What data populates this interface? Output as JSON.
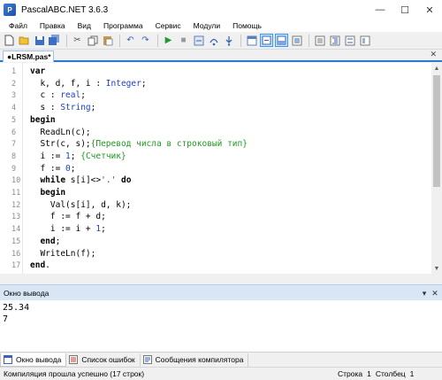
{
  "window": {
    "title": "PascalABC.NET 3.6.3",
    "icon_name": "pascal-app-icon"
  },
  "menu": [
    "Файл",
    "Правка",
    "Вид",
    "Программа",
    "Сервис",
    "Модули",
    "Помощь"
  ],
  "toolbar": {
    "icons": [
      "new-file-icon",
      "open-file-icon",
      "save-icon",
      "save-all-icon",
      "cut-icon",
      "copy-icon",
      "paste-icon",
      "undo-icon",
      "redo-icon",
      "run-icon",
      "stop-icon",
      "compile-icon",
      "step-over-icon",
      "step-into-icon",
      "debug-window-icon",
      "debug-mode-icon",
      "toggle-panel-icon",
      "dock-left-icon",
      "dock-right-icon",
      "format-code-icon"
    ]
  },
  "editor": {
    "tab_label": "●LRSM.pas*",
    "lines": [
      [
        {
          "t": "var",
          "c": "kw"
        }
      ],
      [
        {
          "t": "  k, d, f, i : ",
          "c": "id"
        },
        {
          "t": "Integer",
          "c": "tp"
        },
        {
          "t": ";",
          "c": "id"
        }
      ],
      [
        {
          "t": "  c : ",
          "c": "id"
        },
        {
          "t": "real",
          "c": "tp"
        },
        {
          "t": ";",
          "c": "id"
        }
      ],
      [
        {
          "t": "  s : ",
          "c": "id"
        },
        {
          "t": "String",
          "c": "tp"
        },
        {
          "t": ";",
          "c": "id"
        }
      ],
      [
        {
          "t": "begin",
          "c": "kw"
        }
      ],
      [
        {
          "t": "  ReadLn(c);",
          "c": "id"
        }
      ],
      [
        {
          "t": "  Str(c, s);",
          "c": "id"
        },
        {
          "t": "{Перевод числа в строковый тип}",
          "c": "cm"
        }
      ],
      [
        {
          "t": "  i := ",
          "c": "id"
        },
        {
          "t": "1",
          "c": "nm"
        },
        {
          "t": "; ",
          "c": "id"
        },
        {
          "t": "{Счетчик}",
          "c": "cm"
        }
      ],
      [
        {
          "t": "  f := ",
          "c": "id"
        },
        {
          "t": "0",
          "c": "nm"
        },
        {
          "t": ";",
          "c": "id"
        }
      ],
      [
        {
          "t": "  ",
          "c": "id"
        },
        {
          "t": "while",
          "c": "kw"
        },
        {
          "t": " s[i]<>",
          "c": "id"
        },
        {
          "t": "'.'",
          "c": "st"
        },
        {
          "t": " ",
          "c": "id"
        },
        {
          "t": "do",
          "c": "kw"
        }
      ],
      [
        {
          "t": "  ",
          "c": "id"
        },
        {
          "t": "begin",
          "c": "kw"
        }
      ],
      [
        {
          "t": "    Val(s[i], d, k);",
          "c": "id"
        }
      ],
      [
        {
          "t": "    f := f + d;",
          "c": "id"
        }
      ],
      [
        {
          "t": "    i := i + ",
          "c": "id"
        },
        {
          "t": "1",
          "c": "nm"
        },
        {
          "t": ";",
          "c": "id"
        }
      ],
      [
        {
          "t": "  ",
          "c": "id"
        },
        {
          "t": "end",
          "c": "kw"
        },
        {
          "t": ";",
          "c": "id"
        }
      ],
      [
        {
          "t": "  WriteLn(f);",
          "c": "id"
        }
      ],
      [
        {
          "t": "end",
          "c": "kw"
        },
        {
          "t": ".",
          "c": "id"
        }
      ]
    ]
  },
  "output": {
    "header": "Окно вывода",
    "lines": [
      "25.34",
      "7"
    ]
  },
  "bottom_tabs": [
    {
      "label": "Окно вывода",
      "icon": "output-window-icon",
      "active": true
    },
    {
      "label": "Список ошибок",
      "icon": "error-list-icon",
      "active": false
    },
    {
      "label": "Сообщения компилятора",
      "icon": "compiler-messages-icon",
      "active": false
    }
  ],
  "status": {
    "message": "Компиляция прошла успешно (17 строк)",
    "row_label": "Строка",
    "row_value": "1",
    "col_label": "Столбец",
    "col_value": "1"
  },
  "colors": {
    "keyword": "#000000",
    "type": "#1a3fc7",
    "comment": "#229922",
    "accent": "#2b79d3"
  }
}
